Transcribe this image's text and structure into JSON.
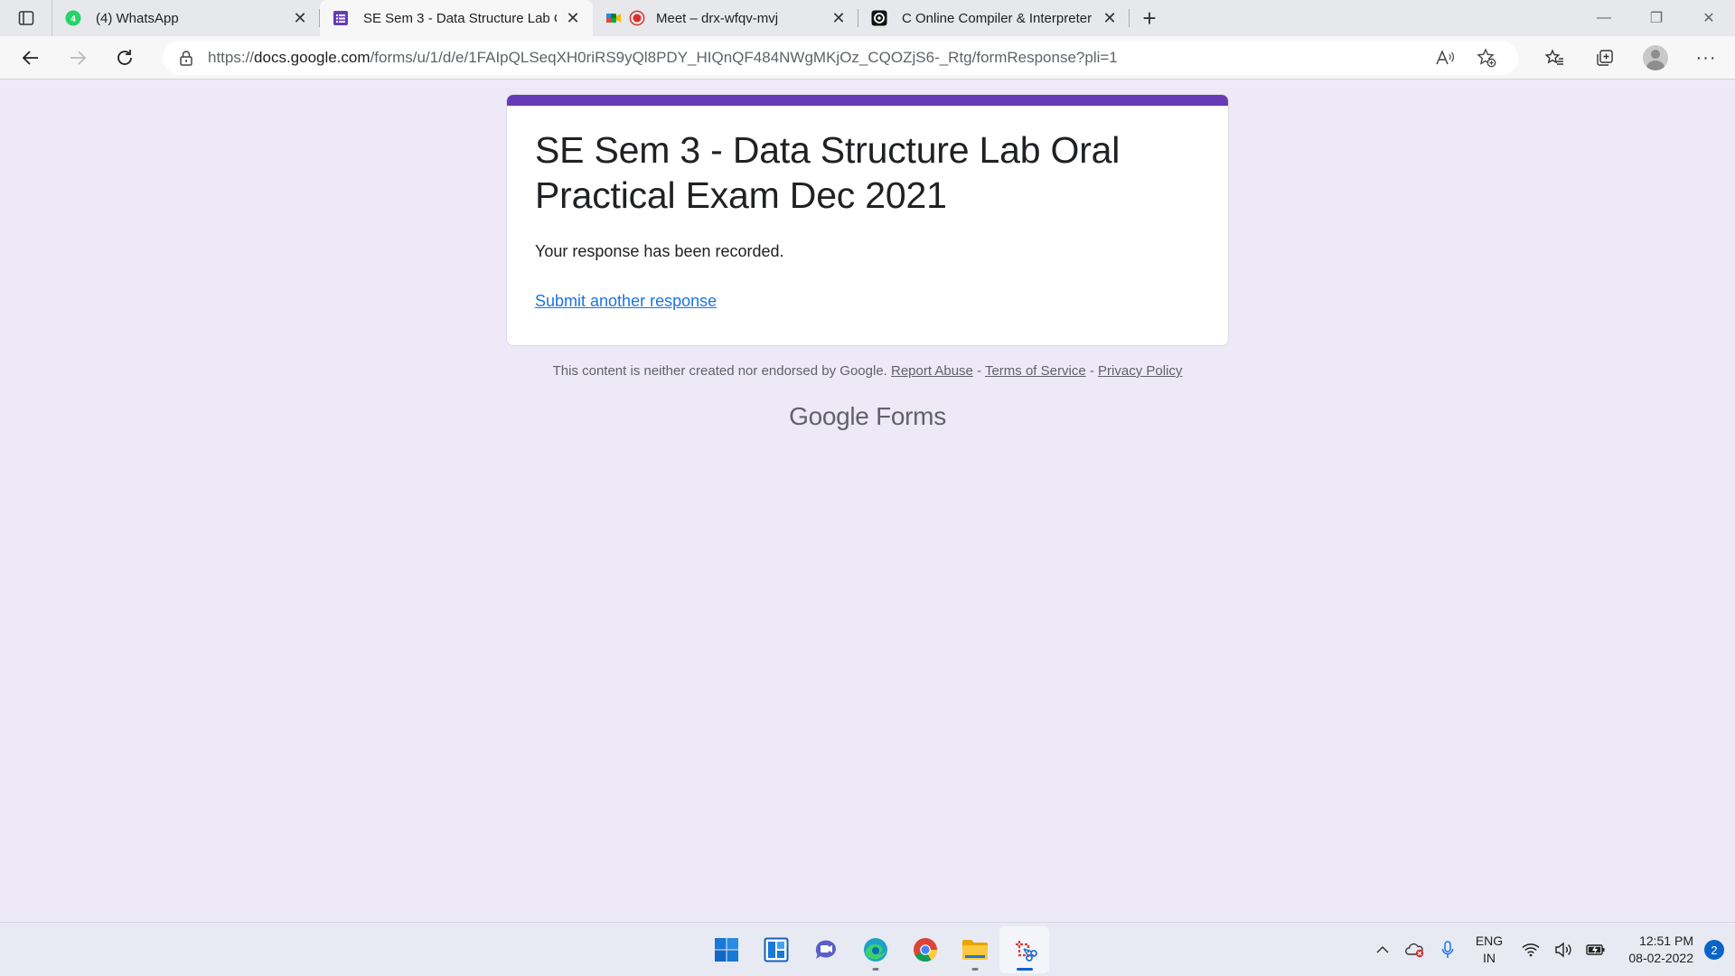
{
  "browser": {
    "tabs": [
      {
        "label": "(4) WhatsApp",
        "icon": "whatsapp-icon"
      },
      {
        "label": "SE Sem 3 - Data Structure Lab Oral Practical Exam Dec 2021",
        "icon": "google-forms-icon",
        "active": true
      },
      {
        "label": "Meet – drx-wfqv-mvj",
        "icon": "google-meet-icon"
      },
      {
        "label": "C Online Compiler & Interpreter",
        "icon": "replit-icon"
      }
    ],
    "url_prefix": "https://",
    "url_domain": "docs.google.com",
    "url_path": "/forms/u/1/d/e/1FAIpQLSeqXH0riRS9yQl8PDY_HIQnQF484NWgMKjOz_CQOZjS6-_Rtg/formResponse?pli=1"
  },
  "form": {
    "title": "SE Sem 3 - Data Structure Lab Oral Practical Exam Dec 2021",
    "message": "Your response has been recorded.",
    "link": "Submit another response",
    "accent": "#673ab7"
  },
  "footer": {
    "disclaimer": "This content is neither created nor endorsed by Google.",
    "report_abuse": "Report Abuse",
    "sep1": " - ",
    "terms": "Terms of Service",
    "sep2": " - ",
    "privacy": "Privacy Policy",
    "brand_google": "Google",
    "brand_forms": "Forms"
  },
  "taskbar": {
    "lang_line1": "ENG",
    "lang_line2": "IN",
    "time": "12:51 PM",
    "date": "08-02-2022",
    "notifications": "2"
  }
}
